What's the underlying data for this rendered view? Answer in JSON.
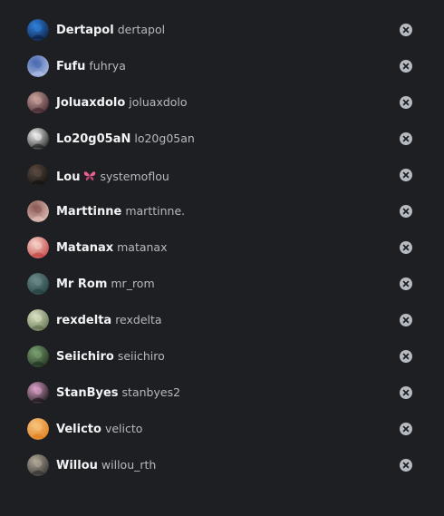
{
  "friends": [
    {
      "display_name": "Dertapol",
      "username": "dertapol",
      "avatar_icon": "user-avatar-icon",
      "avatar_colors": [
        "#0a1a3a",
        "#2f7fd8"
      ]
    },
    {
      "display_name": "Fufu",
      "username": "fuhrya",
      "avatar_icon": "user-avatar-icon",
      "avatar_colors": [
        "#b8c4e8",
        "#4a6ab0"
      ]
    },
    {
      "display_name": "Joluaxdolo",
      "username": "joluaxdolo",
      "avatar_icon": "user-avatar-icon",
      "avatar_colors": [
        "#3a1e2a",
        "#c9a39a"
      ]
    },
    {
      "display_name": "Lo20g05aN",
      "username": "lo20g05an",
      "avatar_icon": "user-avatar-icon",
      "avatar_colors": [
        "#111111",
        "#f0f0f0"
      ]
    },
    {
      "display_name": "Lou",
      "username": "systemoflou",
      "emoji": "butterfly-icon",
      "avatar_icon": "user-avatar-icon",
      "avatar_colors": [
        "#0c0c0c",
        "#5a4a40"
      ]
    },
    {
      "display_name": "Marttinne",
      "username": "marttinne.",
      "avatar_icon": "user-avatar-icon",
      "avatar_colors": [
        "#e8c9c0",
        "#8a5a55"
      ]
    },
    {
      "display_name": "Matanax",
      "username": "matanax",
      "avatar_icon": "user-avatar-icon",
      "avatar_colors": [
        "#c03a3a",
        "#f3d2c8"
      ]
    },
    {
      "display_name": "Mr Rom",
      "username": "mr_rom",
      "avatar_icon": "user-avatar-icon",
      "avatar_colors": [
        "#1f3a3a",
        "#6b8a8a"
      ]
    },
    {
      "display_name": "rexdelta",
      "username": "rexdelta",
      "avatar_icon": "user-avatar-icon",
      "avatar_colors": [
        "#5a6a4a",
        "#d8e0c0"
      ]
    },
    {
      "display_name": "Seiichiro",
      "username": "seiichiro",
      "avatar_icon": "user-avatar-icon",
      "avatar_colors": [
        "#1a2a1a",
        "#7aa070"
      ]
    },
    {
      "display_name": "StanByes",
      "username": "stanbyes2",
      "avatar_icon": "user-avatar-icon",
      "avatar_colors": [
        "#0a0a0a",
        "#d9a0c8"
      ]
    },
    {
      "display_name": "Velicto",
      "username": "velicto",
      "avatar_icon": "user-avatar-icon",
      "avatar_colors": [
        "#e07a1a",
        "#f5c27a"
      ]
    },
    {
      "display_name": "Willou",
      "username": "willou_rth",
      "avatar_icon": "user-avatar-icon",
      "avatar_colors": [
        "#2a2a2a",
        "#b0a898"
      ]
    }
  ],
  "remove_icon": "close-circle-icon",
  "colors": {
    "background": "#1e1f22",
    "display_name": "#f2f3f5",
    "username": "#b5bac1",
    "remove_button": "#b5bac1"
  }
}
